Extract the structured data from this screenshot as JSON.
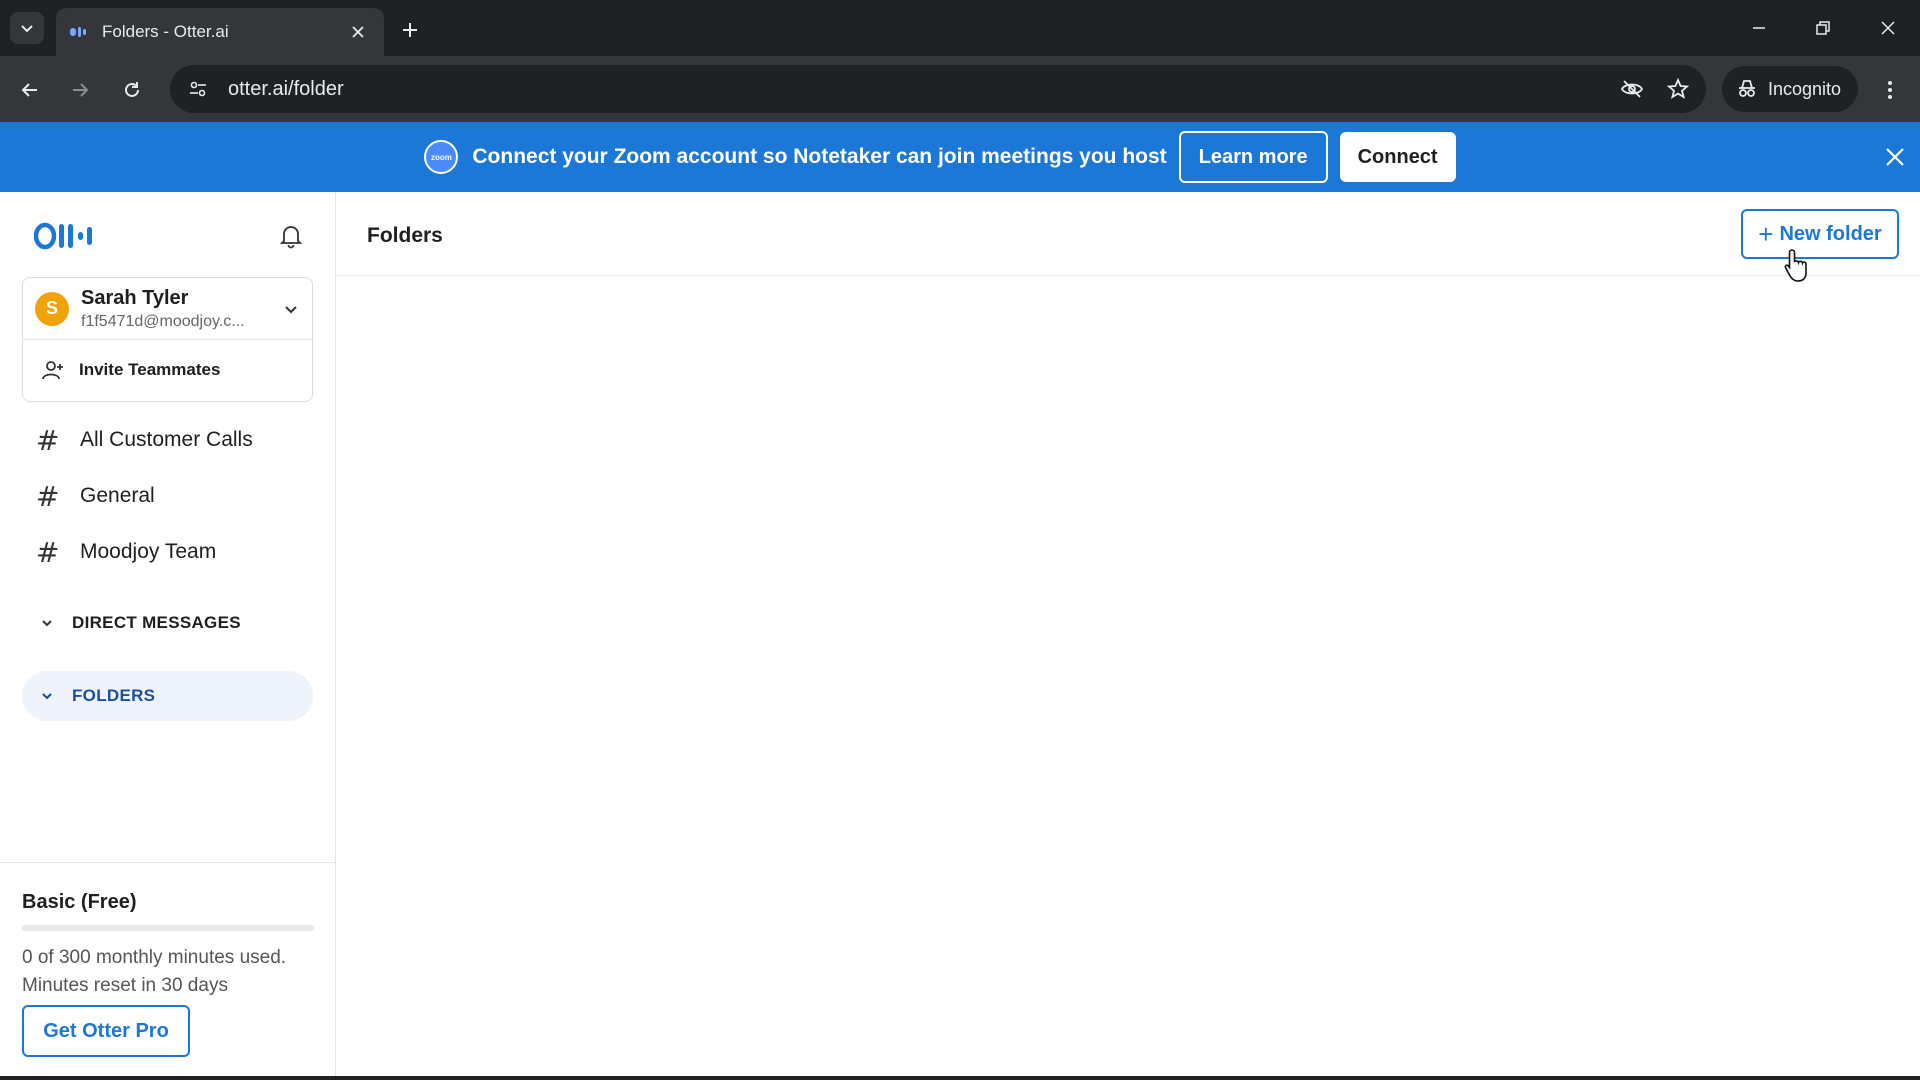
{
  "browser": {
    "tab_title": "Folders - Otter.ai",
    "url": "otter.ai/folder",
    "incognito_label": "Incognito"
  },
  "banner": {
    "logo_text": "zoom",
    "message": "Connect your Zoom account so Notetaker can join meetings you host",
    "learn_more": "Learn more",
    "connect": "Connect"
  },
  "account": {
    "initial": "S",
    "name": "Sarah Tyler",
    "email": "f1f5471d@moodjoy.c...",
    "invite_label": "Invite Teammates"
  },
  "channels": [
    {
      "label": "All Customer Calls"
    },
    {
      "label": "General"
    },
    {
      "label": "Moodjoy Team"
    }
  ],
  "sections": {
    "direct_messages": "DIRECT MESSAGES",
    "folders": "FOLDERS"
  },
  "plan": {
    "title": "Basic (Free)",
    "usage": "0 of 300 monthly minutes used.",
    "reset": "Minutes reset in 30 days",
    "used_fraction": 0,
    "cta": "Get Otter Pro"
  },
  "main": {
    "title": "Folders",
    "new_folder": "New folder"
  },
  "colors": {
    "accent": "#1c78d6",
    "avatar": "#f0a30a"
  }
}
